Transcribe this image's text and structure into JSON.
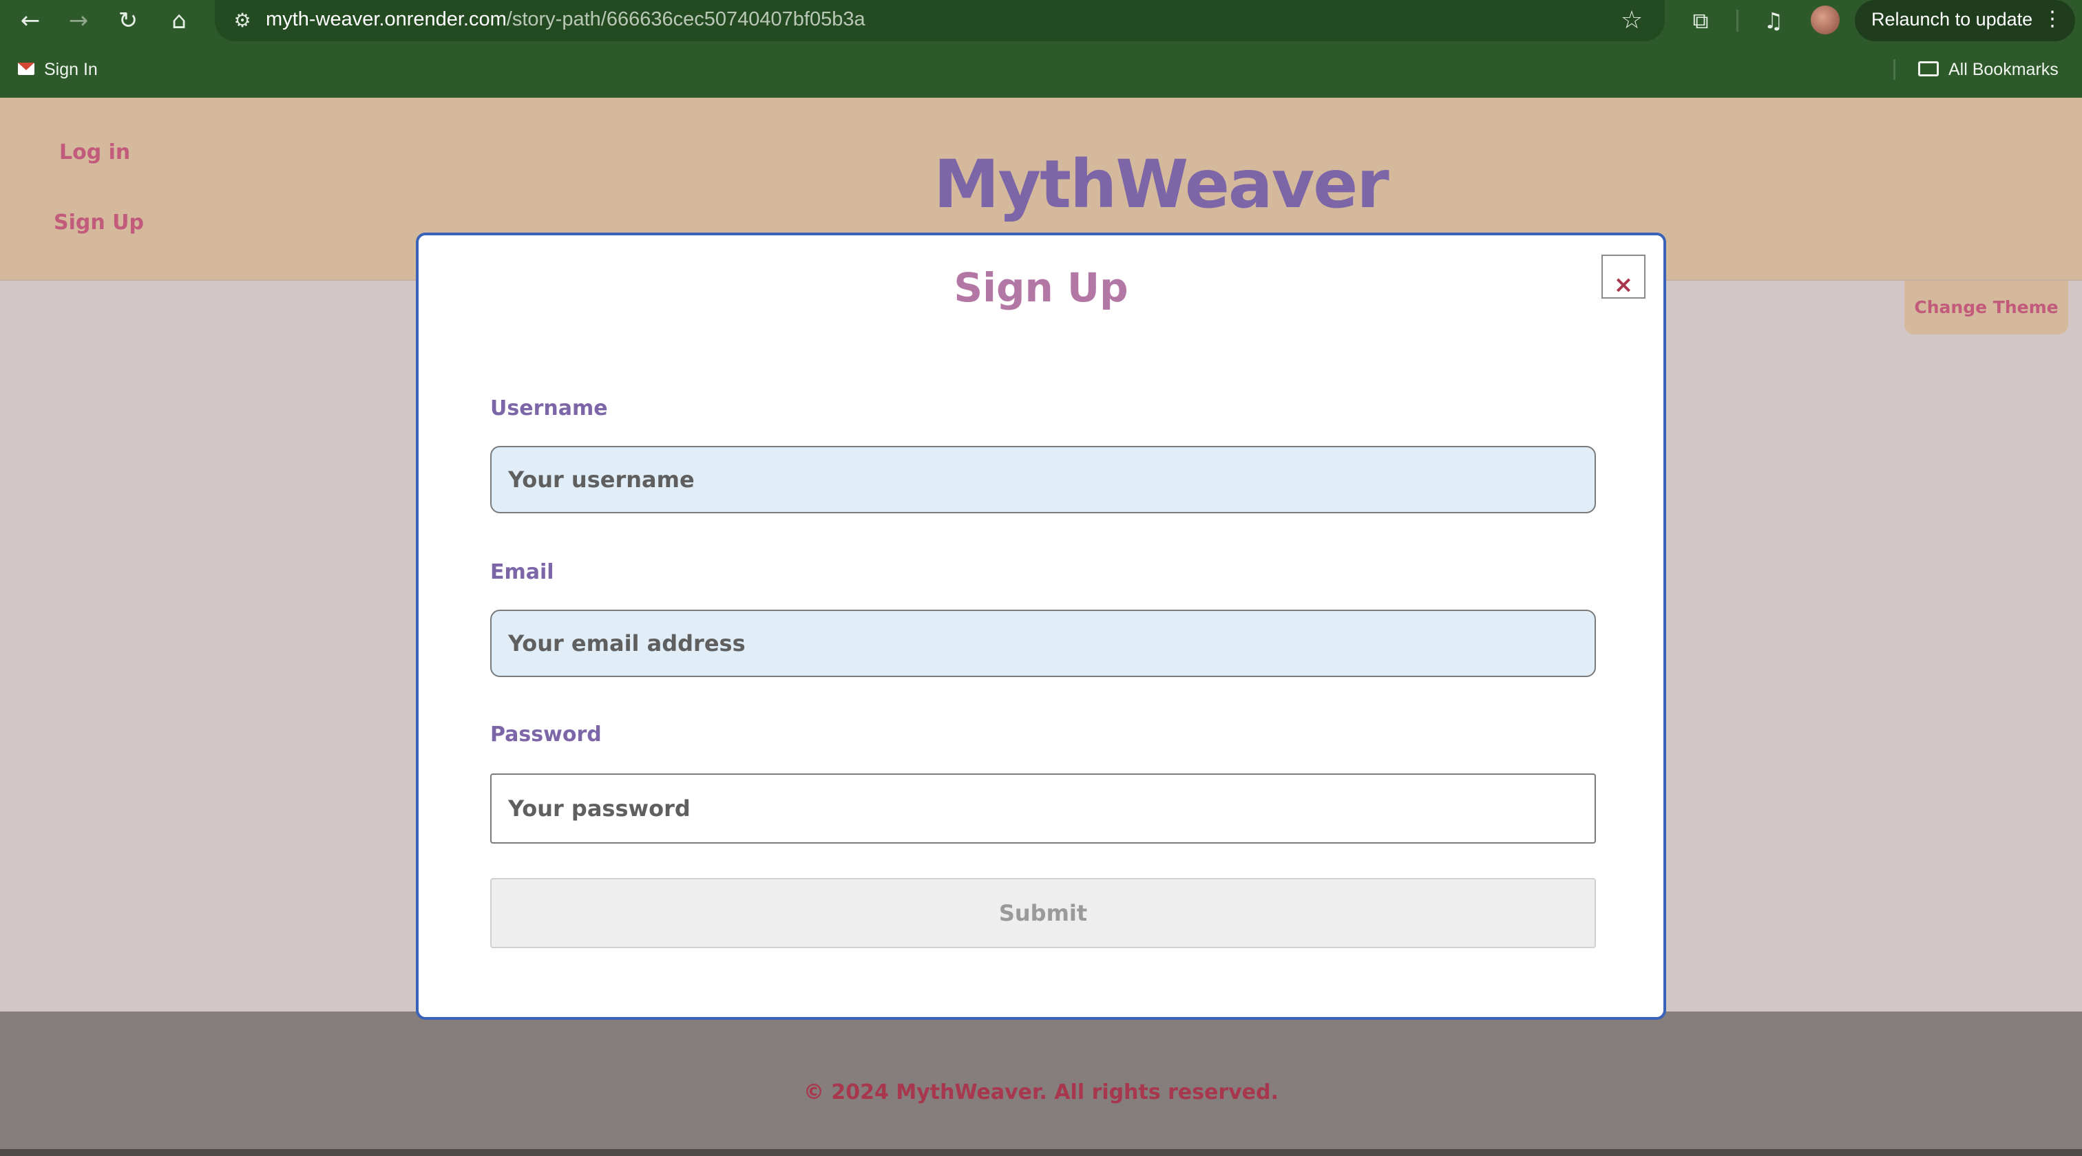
{
  "browser": {
    "url_host": "myth-weaver.onrender.com",
    "url_path": "/story-path/666636cec50740407bf05b3a",
    "relaunch_label": "Relaunch to update",
    "icons": [
      "back-icon",
      "forward-icon",
      "reload-icon",
      "home-icon",
      "site-settings-icon",
      "bookmark-star-icon",
      "extensions-icon",
      "media-icon",
      "profile-avatar",
      "menu-dots-icon"
    ],
    "bookmarks": {
      "items": [
        {
          "label": "Sign In",
          "icon": "gmail-icon"
        }
      ],
      "all_bookmarks_label": "All Bookmarks"
    }
  },
  "header": {
    "nav": {
      "login": "Log in",
      "signup": "Sign Up"
    },
    "brand": "MythWeaver"
  },
  "theme_button": "Change Theme",
  "modal": {
    "title": "Sign Up",
    "close_label": "×",
    "username": {
      "label": "Username",
      "placeholder": "Your username",
      "value": ""
    },
    "email": {
      "label": "Email",
      "placeholder": "Your email address",
      "value": ""
    },
    "password": {
      "label": "Password",
      "placeholder": "Your password",
      "value": ""
    },
    "submit_label": "Submit",
    "submit_state": "disabled"
  },
  "footer": {
    "text": "© 2024 MythWeaver. All rights reserved."
  },
  "colors": {
    "browser_chrome": "#2e5a2b",
    "header_bg": "#d4b99d",
    "page_bg": "#d3c6c6",
    "brand": "#7d66a8",
    "nav_link": "#c25a7b",
    "modal_title": "#b277a4",
    "modal_border": "#3a62b8",
    "input_bg": "#e2eef7",
    "footer_bg": "#857e7d",
    "footer_text": "#a8364d"
  }
}
